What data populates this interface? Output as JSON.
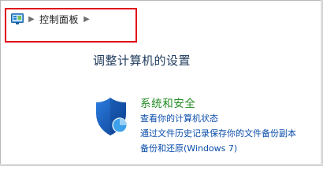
{
  "breadcrumb": {
    "root_icon": "control-panel-icon",
    "items": [
      {
        "label": "控制面板"
      }
    ]
  },
  "main": {
    "title": "调整计算机的设置",
    "categories": [
      {
        "icon": "shield-icon",
        "title": "系统和安全",
        "links": [
          "查看你的计算机状态",
          "通过文件历史记录保存你的文件备份副本",
          "备份和还原(Windows 7)"
        ]
      }
    ]
  },
  "colors": {
    "highlight_box": "#e0000f",
    "title": "#1e395b",
    "category_title": "#228b22",
    "link": "#0a4dab"
  }
}
